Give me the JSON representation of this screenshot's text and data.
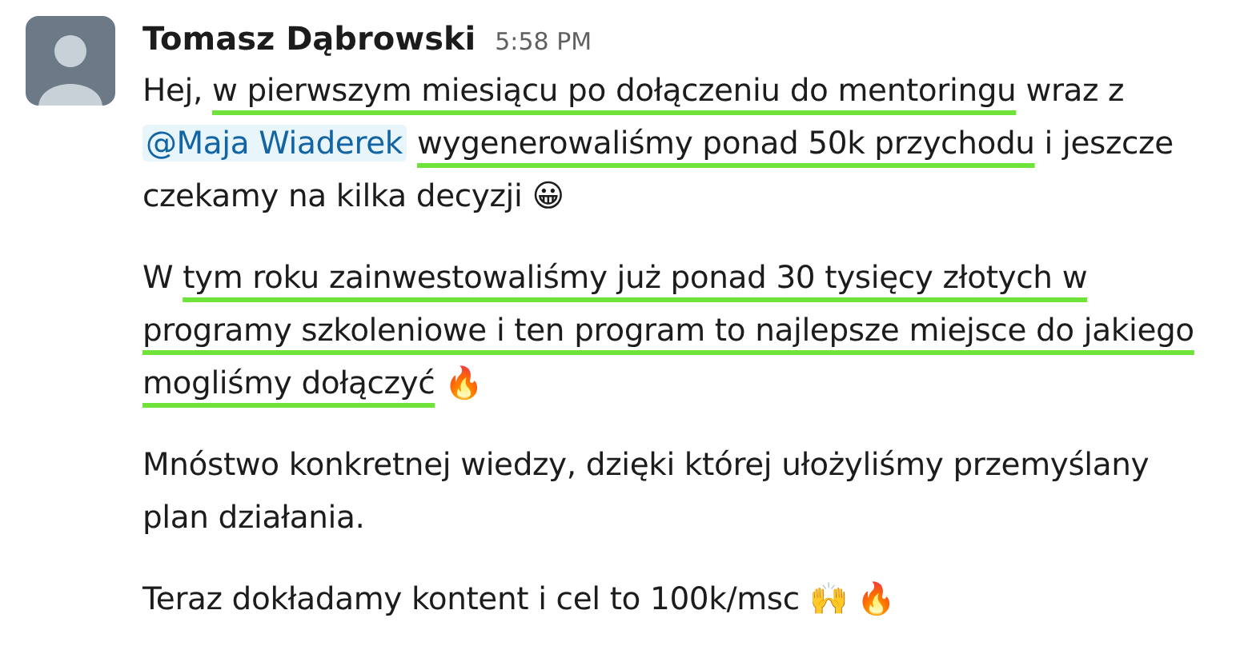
{
  "message": {
    "author": "Tomasz Dąbrowski",
    "time": "5:58 PM",
    "paragraphs": [
      {
        "segments": [
          {
            "kind": "text",
            "text": "Hej, "
          },
          {
            "kind": "underlined",
            "text": "w pierwszym miesiącu po dołączeniu do mentoringu"
          },
          {
            "kind": "text",
            "text": " wraz z "
          },
          {
            "kind": "mention",
            "text": "@Maja Wiaderek"
          },
          {
            "kind": "underlined",
            "text": "wygenerowaliśmy ponad 50k przychodu"
          },
          {
            "kind": "text",
            "text": " i jeszcze czekamy na kilka decyzji 😀"
          }
        ]
      },
      {
        "segments": [
          {
            "kind": "text",
            "text": "W "
          },
          {
            "kind": "underlined",
            "text": "tym roku zainwestowaliśmy już ponad 30 tysięcy złotych w programy szkoleniowe i ten program to najlepsze miejsce do jakiego mogliśmy dołączyć"
          },
          {
            "kind": "text",
            "text": " 🔥"
          }
        ]
      },
      {
        "segments": [
          {
            "kind": "text",
            "text": "Mnóstwo konkretnej wiedzy, dzięki której ułożyliśmy przemyślany plan działania."
          }
        ]
      },
      {
        "segments": [
          {
            "kind": "text",
            "text": "Teraz dokładamy kontent i cel to 100k/msc 🙌 🔥"
          }
        ]
      }
    ]
  }
}
